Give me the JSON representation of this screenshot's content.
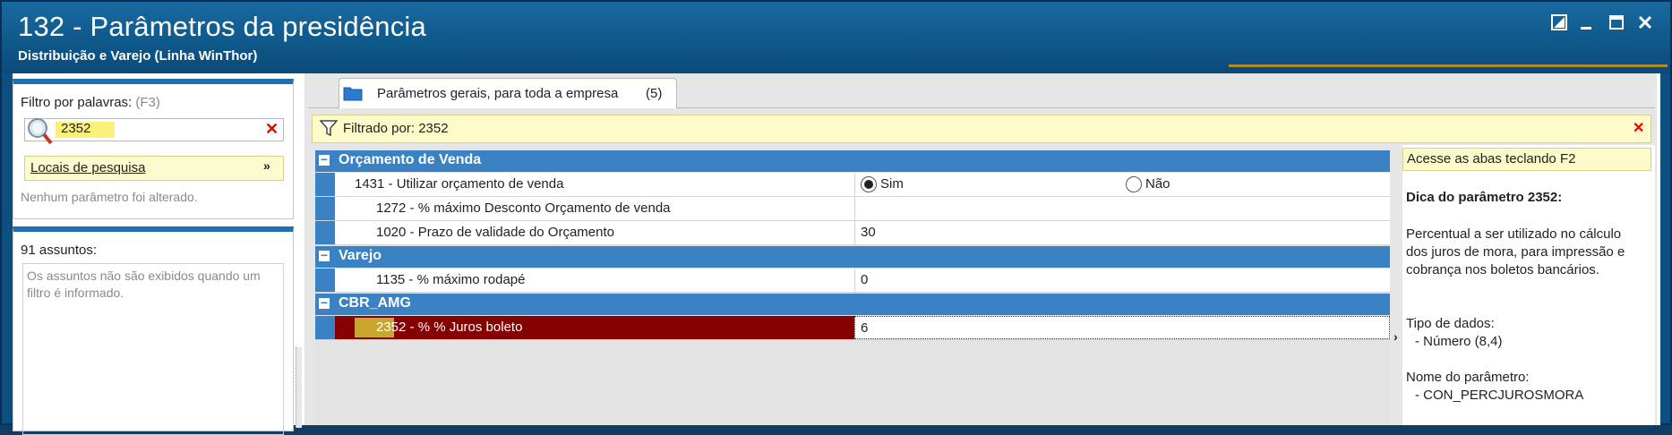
{
  "window": {
    "title": "132 - Parâmetros da presidência",
    "subtitle": "Distribuição e Varejo (Linha WinThor)"
  },
  "filter_panel": {
    "label": "Filtro por palavras:",
    "shortcut": "(F3)",
    "value": "2352",
    "locais_label": "Locais de pesquisa",
    "status": "Nenhum parâmetro foi alterado."
  },
  "subjects_panel": {
    "count_label": "91 assuntos:",
    "message": "Os assuntos não são exibidos quando um filtro é informado."
  },
  "tab": {
    "label": "Parâmetros gerais, para toda a empresa",
    "count": "(5)"
  },
  "filter_bar": {
    "label": "Filtrado por: 2352"
  },
  "groups": [
    {
      "title": "Orçamento  de Venda",
      "rows": [
        {
          "name": "1431 - Utilizar orçamento de venda",
          "opt_yes": "Sim",
          "opt_no": "Não",
          "selected": "Sim"
        },
        {
          "name": "1272 - % máximo Desconto Orçamento de venda",
          "value": ""
        },
        {
          "name": "1020 - Prazo de validade do Orçamento",
          "value": "30"
        }
      ]
    },
    {
      "title": "Varejo",
      "rows": [
        {
          "name": "1135 - % máximo rodapé",
          "value": "0"
        }
      ]
    },
    {
      "title": "CBR_AMG",
      "rows": [
        {
          "num": "2352",
          "name": " - % % Juros boleto",
          "value": "6"
        }
      ]
    }
  ],
  "hint": {
    "top": "Acesse as abas teclando F2",
    "title": "Dica do parâmetro 2352:",
    "desc1": "Percentual a ser utilizado no cálculo",
    "desc2": "dos juros de mora, para impressão e",
    "desc3": "cobrança nos boletos bancários.",
    "type_label": "Tipo de dados:",
    "type_value": "- Número (8,4)",
    "name_label": "Nome do parâmetro:",
    "name_value": "- CON_PERCJUROSMORA"
  },
  "colors": {
    "accent_blue": "#3a82c4",
    "selected_row": "#850000",
    "highlight": "#fbf078"
  }
}
